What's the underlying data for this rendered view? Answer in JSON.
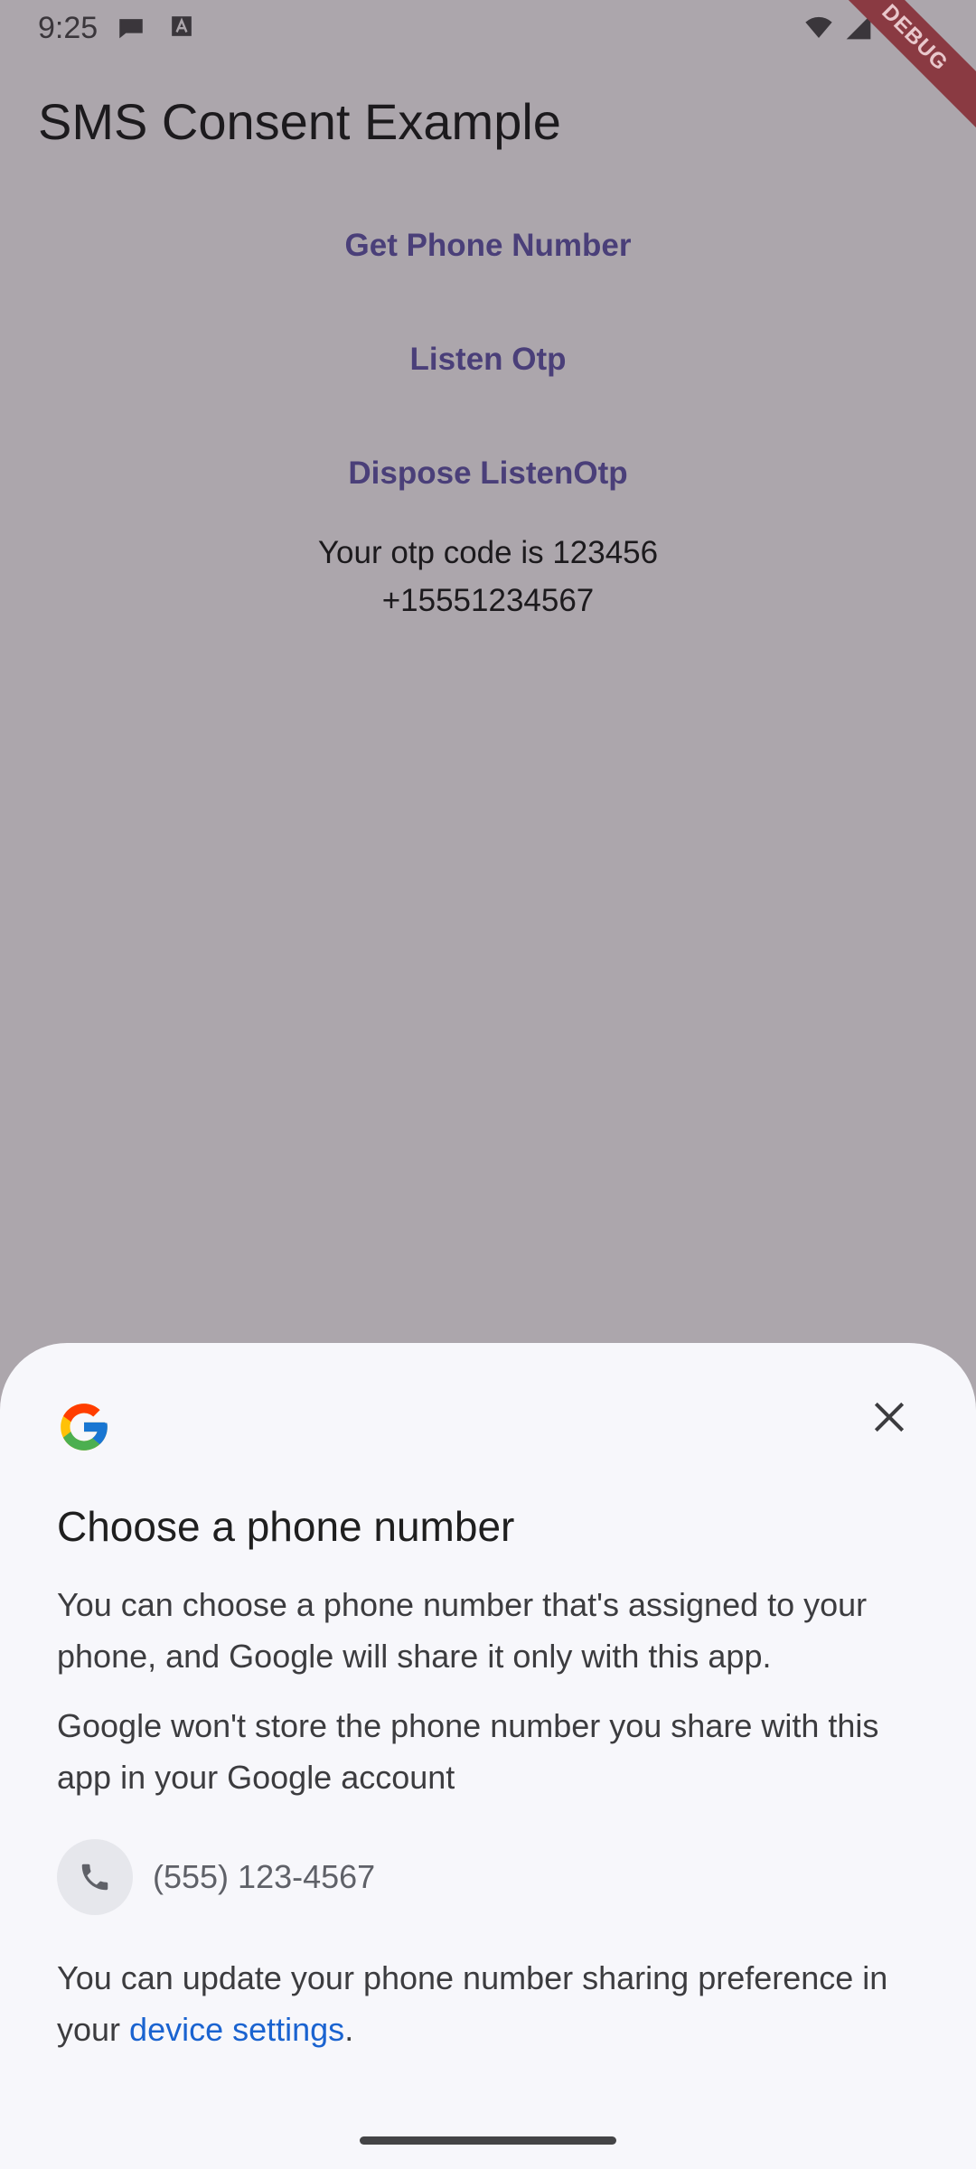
{
  "status_bar": {
    "time": "9:25",
    "icons_left": [
      "chat-bubble-icon",
      "font-a-icon"
    ],
    "icons_right": [
      "wifi-icon",
      "cell-signal-icon",
      "battery-icon"
    ]
  },
  "debug_banner": "DEBUG",
  "app": {
    "title": "SMS Consent Example",
    "buttons": {
      "get_phone": "Get Phone Number",
      "listen_otp": "Listen Otp",
      "dispose_listen": "Dispose ListenOtp"
    },
    "otp_text": "Your otp code is 123456",
    "phone_text": "+15551234567"
  },
  "sheet": {
    "logo": "google-g-icon",
    "title": "Choose a phone number",
    "paragraph_1": "You can choose a phone number that's assigned to your phone, and Google will share it only with this app.",
    "paragraph_2": "Google won't store the phone number you share with this app in your Google account",
    "phone_option": "(555) 123-4567",
    "footer_prefix": "You can update your phone number sharing preference in your ",
    "footer_link": "device settings",
    "footer_suffix": "."
  },
  "colors": {
    "accent": "#4a3f79",
    "link": "#1a63d0",
    "scrim_bg": "#aca6ac",
    "sheet_bg": "#f7f7fb"
  }
}
